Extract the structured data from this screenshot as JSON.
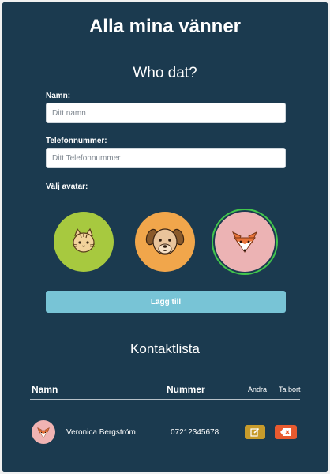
{
  "header": {
    "title": "Alla mina vänner"
  },
  "form": {
    "title": "Who dat?",
    "name_label": "Namn:",
    "name_placeholder": "Ditt namn",
    "phone_label": "Telefonnummer:",
    "phone_placeholder": "Ditt Telefonnummer",
    "avatar_label": "Välj avatar:",
    "avatars": [
      {
        "icon": "cat-icon",
        "color": "#a7c93f",
        "selected": false
      },
      {
        "icon": "dog-icon",
        "color": "#f1a64b",
        "selected": false
      },
      {
        "icon": "fox-icon",
        "color": "#ecb3b4",
        "selected": true
      }
    ],
    "submit_label": "Lägg till"
  },
  "contacts": {
    "title": "Kontaktlista",
    "columns": {
      "name": "Namn",
      "number": "Nummer",
      "edit": "Ändra",
      "delete": "Ta bort"
    },
    "rows": [
      {
        "avatar": "fox-icon",
        "name": "Veronica Bergström",
        "number": "07212345678"
      }
    ]
  },
  "colors": {
    "background": "#1b3a4f",
    "accent_button": "#78c4d6",
    "edit_button": "#c79b2b",
    "delete_button": "#e85a2f",
    "selected_ring": "#42c64c"
  }
}
